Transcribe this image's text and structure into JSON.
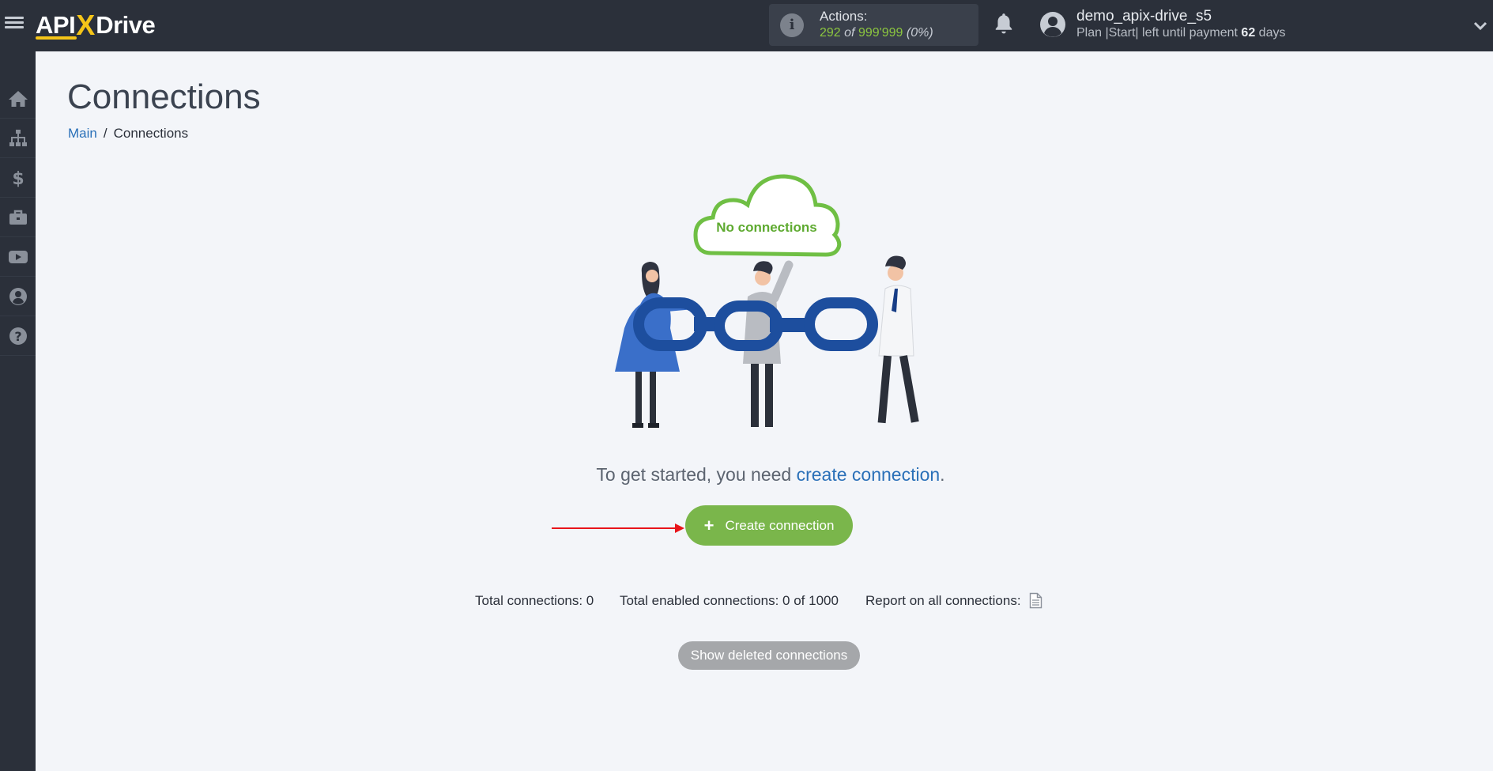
{
  "brand": {
    "logo_left": "API",
    "logo_x": "X",
    "logo_right": "Drive"
  },
  "header": {
    "actions_label": "Actions:",
    "actions_used": "292",
    "actions_of": "of",
    "actions_total": "999'999",
    "actions_percent": "(0%)",
    "username": "demo_apix-drive_s5",
    "plan_prefix": "Plan |Start| left until payment",
    "plan_days": "62",
    "plan_suffix": "days"
  },
  "sidebar": {
    "items": [
      {
        "name": "home",
        "icon": "home-icon"
      },
      {
        "name": "connections",
        "icon": "sitemap-icon"
      },
      {
        "name": "billing",
        "icon": "dollar-icon"
      },
      {
        "name": "tools",
        "icon": "briefcase-icon"
      },
      {
        "name": "videos",
        "icon": "youtube-icon"
      },
      {
        "name": "account",
        "icon": "user-circle-icon"
      },
      {
        "name": "help",
        "icon": "question-circle-icon"
      }
    ]
  },
  "page": {
    "title": "Connections",
    "breadcrumb_main": "Main",
    "breadcrumb_sep": "/",
    "breadcrumb_current": "Connections"
  },
  "empty_state": {
    "cloud_text": "No connections",
    "prompt_text": "To get started, you need",
    "prompt_link": "create connection",
    "prompt_end": ".",
    "create_button": "Create connection"
  },
  "stats": {
    "total_connections": "Total connections: 0",
    "total_enabled": "Total enabled connections: 0 of 1000",
    "report_label": "Report on all connections:"
  },
  "footer": {
    "show_deleted_button": "Show deleted connections"
  },
  "colors": {
    "topbar": "#2b303a",
    "accent_green": "#7ab64b",
    "link_blue": "#2a70b8",
    "brand_yellow": "#f5c518",
    "annotation_red": "#e8141b"
  }
}
